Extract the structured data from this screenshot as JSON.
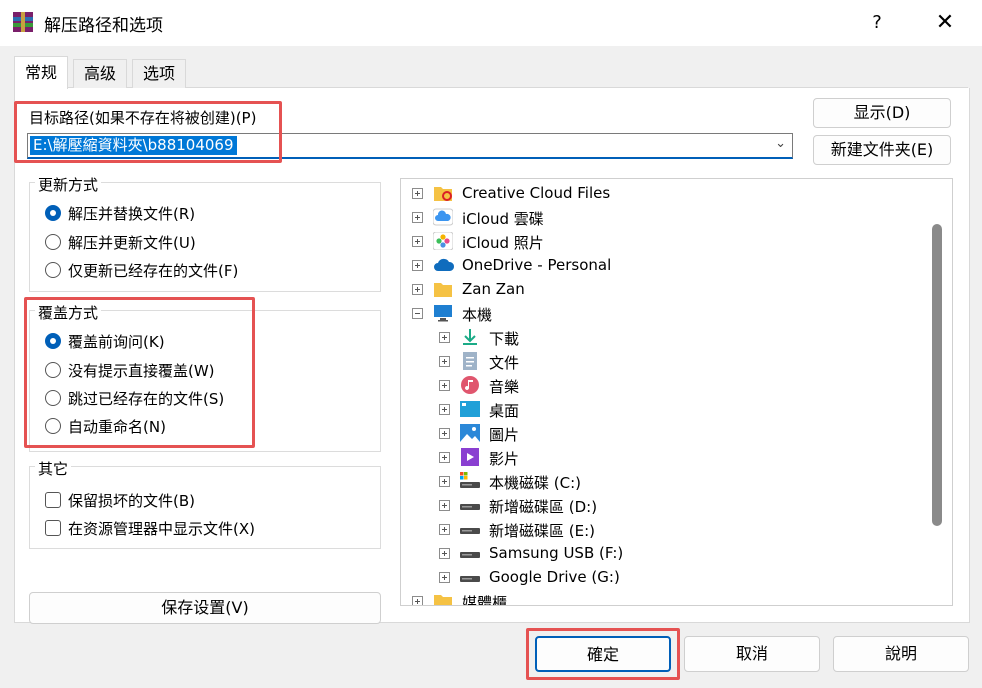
{
  "window": {
    "title": "解压路径和选项",
    "help_label": "?",
    "close_label": "✕"
  },
  "tabs": [
    {
      "label": "常规",
      "active": true
    },
    {
      "label": "高级",
      "active": false
    },
    {
      "label": "选项",
      "active": false
    }
  ],
  "target_path": {
    "label": "目标路径(如果不存在将被创建)(P)",
    "value": "E:\\解壓縮資料夾\\b88104069"
  },
  "buttons": {
    "show": "显示(D)",
    "new_folder": "新建文件夹(E)",
    "save_settings": "保存设置(V)",
    "ok": "確定",
    "cancel": "取消",
    "help": "說明"
  },
  "update_mode": {
    "title": "更新方式",
    "options": [
      {
        "label": "解压并替换文件(R)",
        "checked": true
      },
      {
        "label": "解压并更新文件(U)",
        "checked": false
      },
      {
        "label": "仅更新已经存在的文件(F)",
        "checked": false
      }
    ]
  },
  "overwrite_mode": {
    "title": "覆盖方式",
    "options": [
      {
        "label": "覆盖前询问(K)",
        "checked": true
      },
      {
        "label": "没有提示直接覆盖(W)",
        "checked": false
      },
      {
        "label": "跳过已经存在的文件(S)",
        "checked": false
      },
      {
        "label": "自动重命名(N)",
        "checked": false
      }
    ]
  },
  "misc": {
    "title": "其它",
    "options": [
      {
        "label": "保留损坏的文件(B)",
        "checked": false
      },
      {
        "label": "在资源管理器中显示文件(X)",
        "checked": false
      }
    ]
  },
  "tree": [
    {
      "label": "Creative Cloud Files",
      "icon": "creative-cloud-folder-icon",
      "level": 0
    },
    {
      "label": "iCloud 雲碟",
      "icon": "icloud-drive-icon",
      "level": 0
    },
    {
      "label": "iCloud 照片",
      "icon": "icloud-photos-icon",
      "level": 0
    },
    {
      "label": "OneDrive - Personal",
      "icon": "onedrive-icon",
      "level": 0
    },
    {
      "label": "Zan Zan",
      "icon": "folder-icon",
      "level": 0
    },
    {
      "label": "本機",
      "icon": "this-pc-icon",
      "level": 0,
      "expanded": true
    },
    {
      "label": "下載",
      "icon": "downloads-icon",
      "level": 1
    },
    {
      "label": "文件",
      "icon": "documents-icon",
      "level": 1
    },
    {
      "label": "音樂",
      "icon": "music-icon",
      "level": 1
    },
    {
      "label": "桌面",
      "icon": "desktop-icon",
      "level": 1
    },
    {
      "label": "圖片",
      "icon": "pictures-icon",
      "level": 1
    },
    {
      "label": "影片",
      "icon": "videos-icon",
      "level": 1
    },
    {
      "label": "本機磁碟 (C:)",
      "icon": "system-drive-icon",
      "level": 1
    },
    {
      "label": "新增磁碟區 (D:)",
      "icon": "drive-icon",
      "level": 1
    },
    {
      "label": "新增磁碟區 (E:)",
      "icon": "drive-icon",
      "level": 1
    },
    {
      "label": "Samsung USB (F:)",
      "icon": "drive-icon",
      "level": 1
    },
    {
      "label": "Google Drive (G:)",
      "icon": "drive-icon",
      "level": 1
    },
    {
      "label": "媒體櫃",
      "icon": "library-folder-icon",
      "level": 0
    }
  ],
  "colors": {
    "accent": "#005fb8",
    "highlight": "#e55252",
    "selection": "#0078d7"
  }
}
